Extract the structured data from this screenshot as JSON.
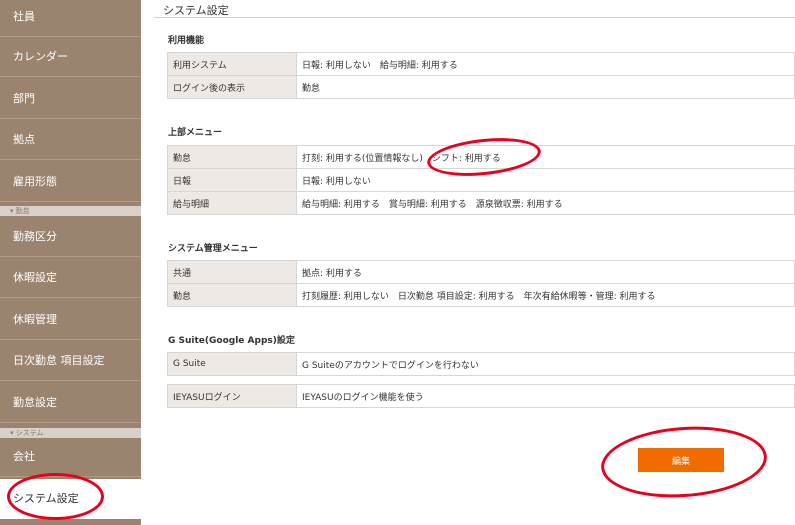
{
  "sidebar": {
    "items": [
      {
        "label": "社員"
      },
      {
        "label": "カレンダー"
      },
      {
        "label": "部門"
      },
      {
        "label": "拠点"
      },
      {
        "label": "雇用形態"
      },
      {
        "label": "勤務区分"
      },
      {
        "label": "休暇設定"
      },
      {
        "label": "休暇管理"
      },
      {
        "label": "日次勤怠 項目設定"
      },
      {
        "label": "勤怠設定"
      },
      {
        "label": "会社"
      },
      {
        "label": "システム設定"
      }
    ],
    "separators": [
      {
        "label": "▾ 勤怠"
      },
      {
        "label": "▾ システム"
      }
    ]
  },
  "main": {
    "title": "システム設定",
    "sections": [
      {
        "title": "利用機能",
        "rows": [
          {
            "label": "利用システム",
            "value": "日報: 利用しない　給与明細: 利用する"
          },
          {
            "label": "ログイン後の表示",
            "value": "勤怠"
          }
        ]
      },
      {
        "title": "上部メニュー",
        "rows": [
          {
            "label": "勤怠",
            "value": "打刻: 利用する(位置情報なし)　シフト: 利用する"
          },
          {
            "label": "日報",
            "value": "日報: 利用しない"
          },
          {
            "label": "給与明細",
            "value": "給与明細: 利用する　賞与明細: 利用する　源泉徴収票: 利用する"
          }
        ]
      },
      {
        "title": "システム管理メニュー",
        "rows": [
          {
            "label": "共通",
            "value": "拠点: 利用する"
          },
          {
            "label": "勤怠",
            "value": "打刻履歴: 利用しない　日次勤怠 項目設定: 利用する　年次有給休暇等・管理: 利用する"
          }
        ]
      },
      {
        "title": "G Suite(Google Apps)設定",
        "rows": [
          {
            "label": "G Suite",
            "value": "G Suiteのアカウントでログインを行わない"
          },
          {
            "label": "IEYASUログイン",
            "value": "IEYASUのログイン機能を使う"
          }
        ]
      }
    ],
    "edit_button": "編集"
  },
  "colors": {
    "sidebar_bg": "#9a8470",
    "label_bg": "#efe9e5",
    "button": "#f06c00",
    "annotation": "#e8001c"
  }
}
